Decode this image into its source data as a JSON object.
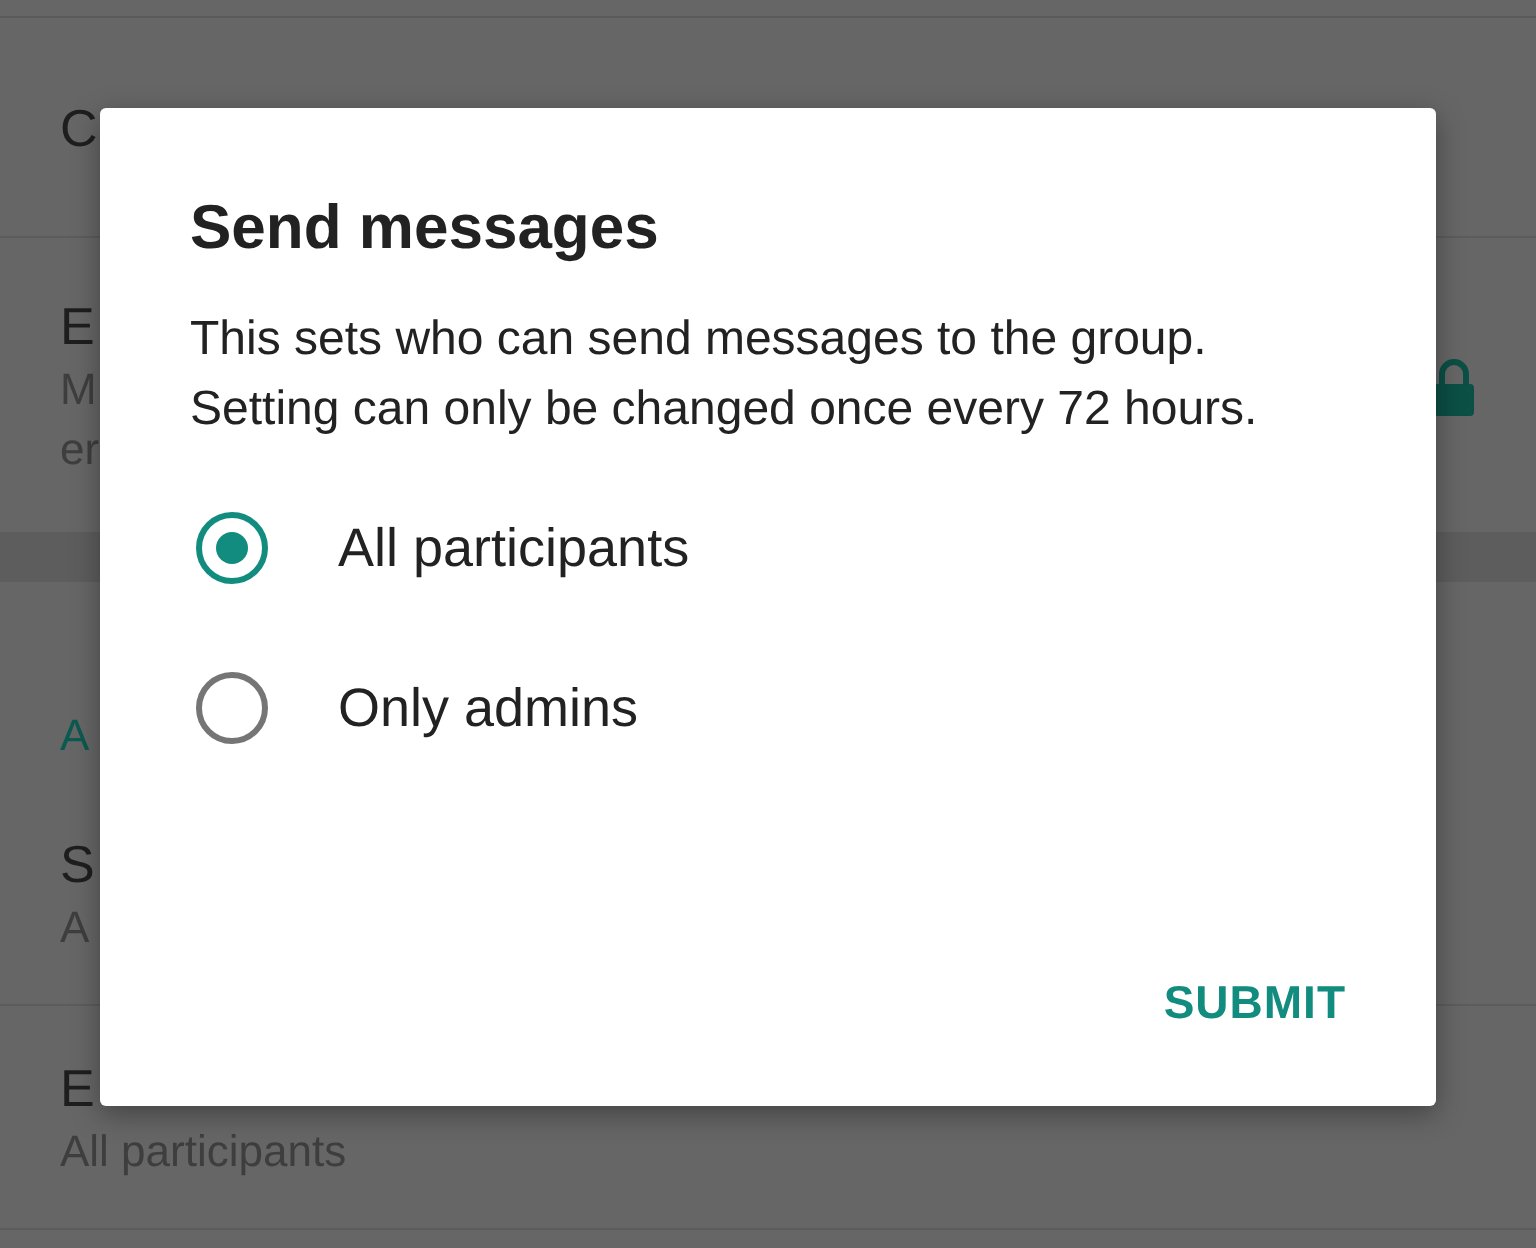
{
  "background": {
    "rows": [
      {
        "kind": "item",
        "title": "C"
      },
      {
        "kind": "item",
        "title": "E",
        "subtitle_lines": [
          "M",
          "er"
        ],
        "locked": true
      },
      {
        "kind": "header",
        "title": "A"
      },
      {
        "kind": "item",
        "title": "S",
        "subtitle_lines": [
          "A"
        ]
      },
      {
        "kind": "item",
        "title": "E",
        "subtitle_lines": [
          "All participants"
        ]
      }
    ]
  },
  "dialog": {
    "title": "Send messages",
    "message": "This sets who can send messages to the group. Setting can only be changed once every 72 hours.",
    "options": [
      {
        "label": "All participants",
        "selected": true
      },
      {
        "label": "Only admins",
        "selected": false
      }
    ],
    "button": "SUBMIT"
  }
}
